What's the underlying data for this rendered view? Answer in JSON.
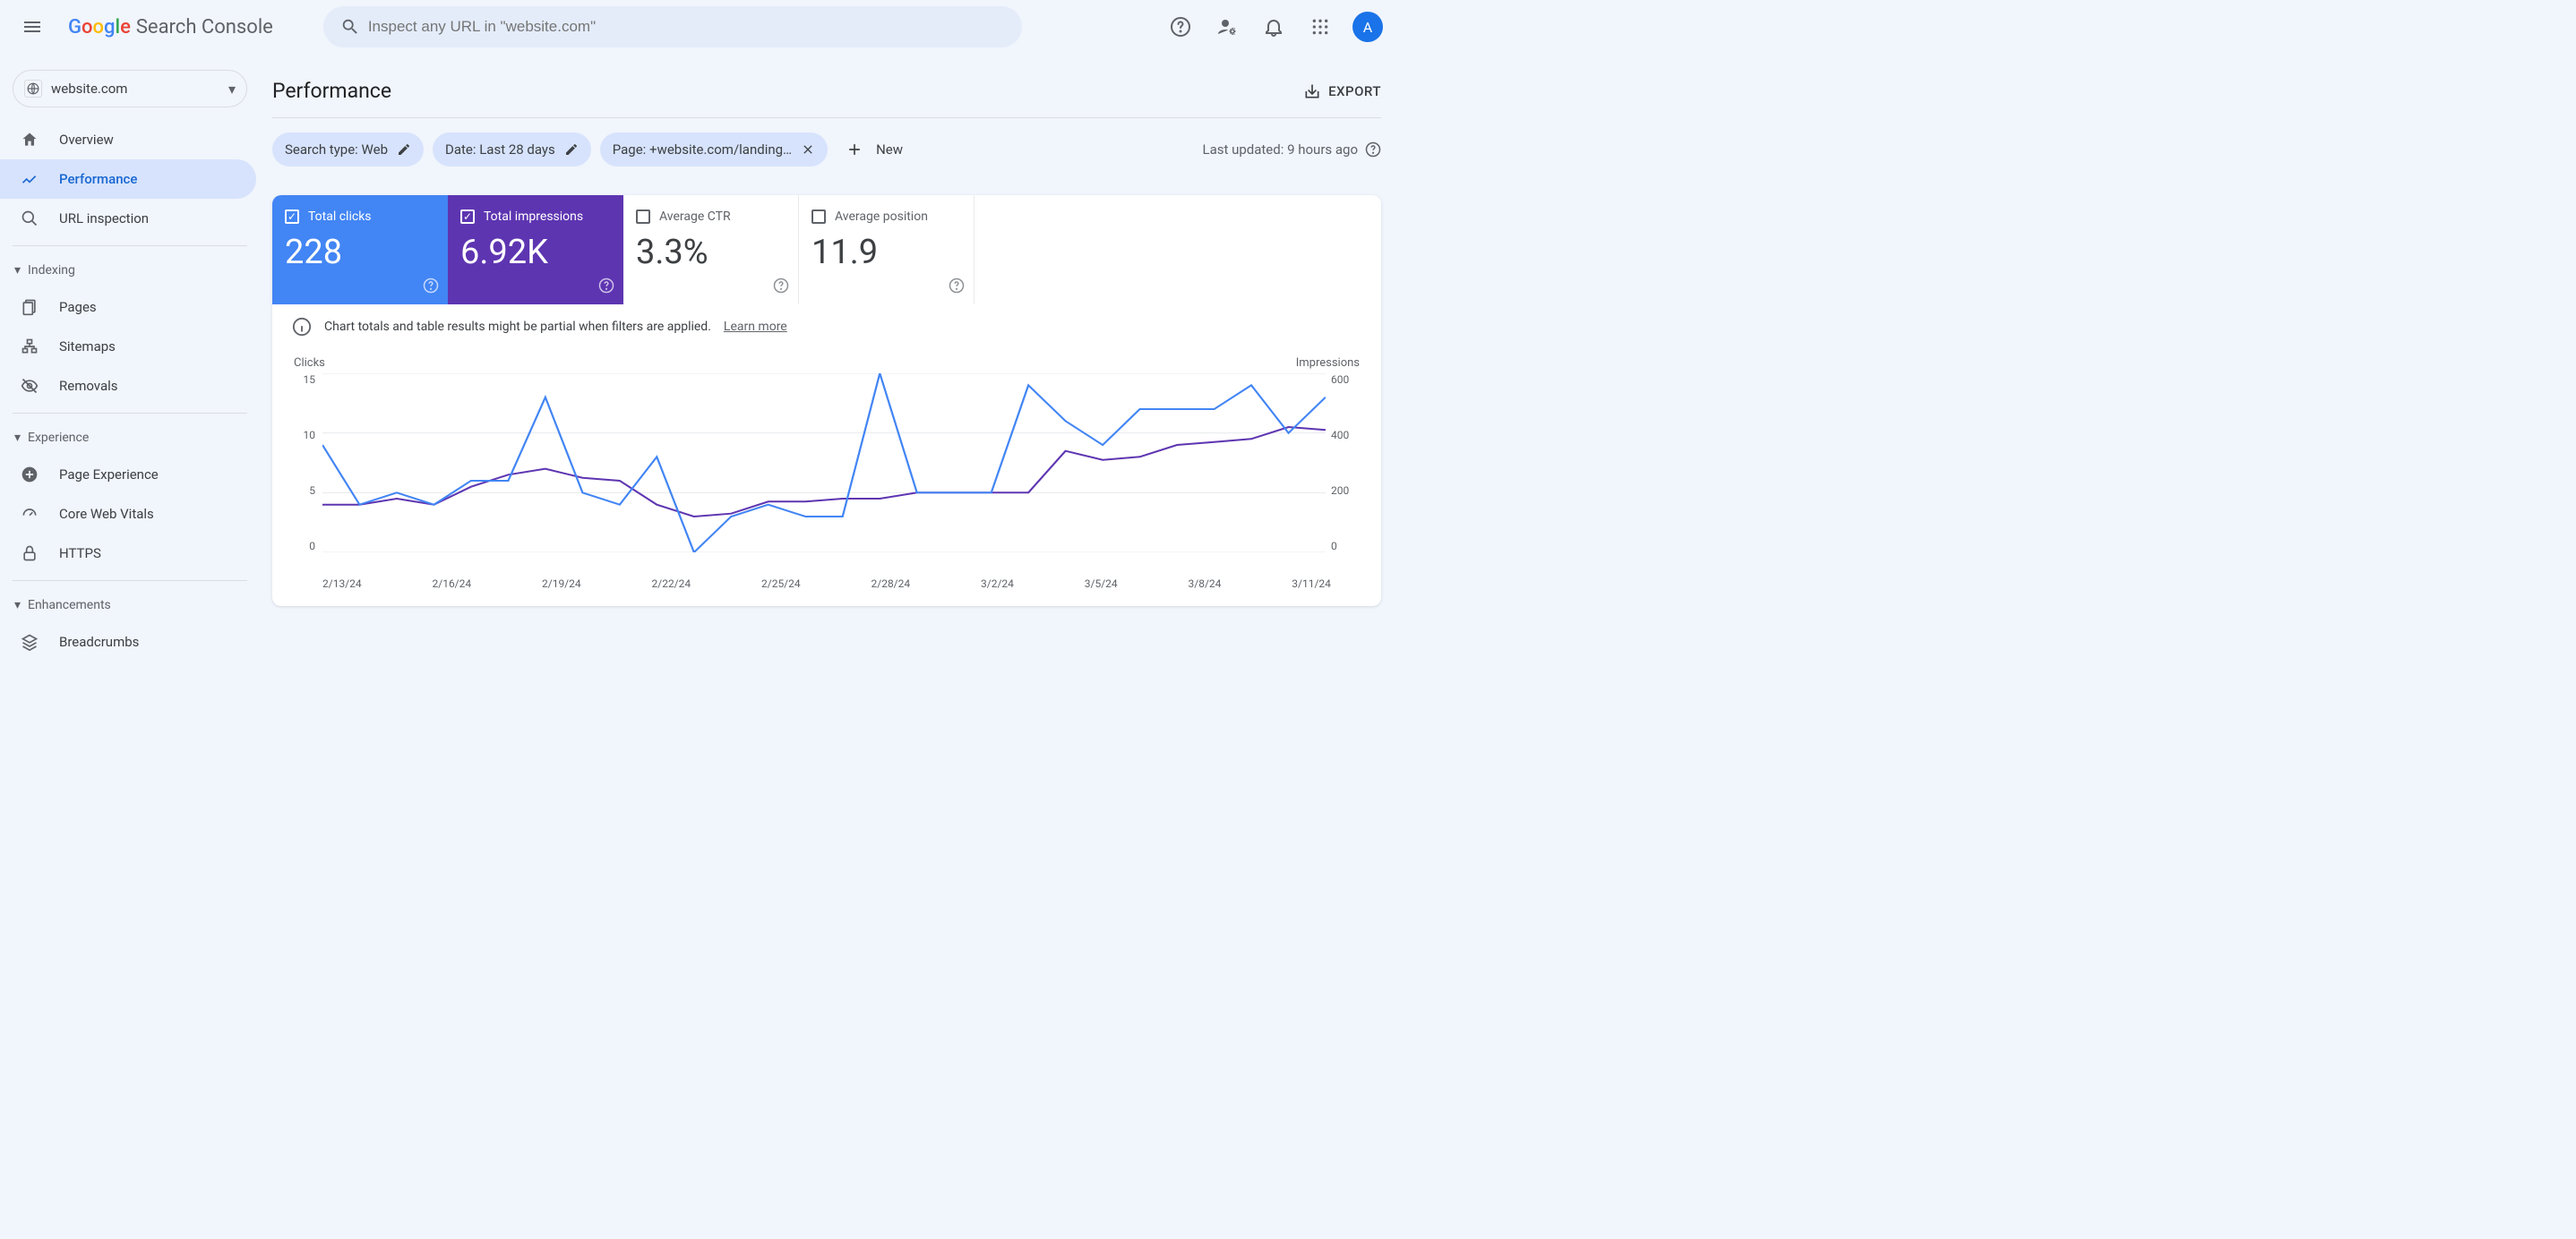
{
  "header": {
    "logo_text": "Search Console",
    "search_placeholder": "Inspect any URL in \"website.com\"",
    "avatar_letter": "A"
  },
  "sidebar": {
    "property": "website.com",
    "items": [
      {
        "id": "overview",
        "label": "Overview"
      },
      {
        "id": "performance",
        "label": "Performance"
      },
      {
        "id": "url-inspection",
        "label": "URL inspection"
      }
    ],
    "groups": {
      "indexing": {
        "label": "Indexing",
        "items": [
          {
            "id": "pages",
            "label": "Pages"
          },
          {
            "id": "sitemaps",
            "label": "Sitemaps"
          },
          {
            "id": "removals",
            "label": "Removals"
          }
        ]
      },
      "experience": {
        "label": "Experience",
        "items": [
          {
            "id": "page-experience",
            "label": "Page Experience"
          },
          {
            "id": "core-web-vitals",
            "label": "Core Web Vitals"
          },
          {
            "id": "https",
            "label": "HTTPS"
          }
        ]
      },
      "enhancements": {
        "label": "Enhancements",
        "items": [
          {
            "id": "breadcrumbs",
            "label": "Breadcrumbs"
          }
        ]
      }
    }
  },
  "page": {
    "title": "Performance",
    "export_label": "EXPORT",
    "last_updated": "Last updated: 9 hours ago",
    "filters": {
      "search_type": "Search type: Web",
      "date": "Date: Last 28 days",
      "page": "Page: +website.com/landing…",
      "new_label": "New"
    },
    "metrics": {
      "clicks": {
        "label": "Total clicks",
        "value": "228"
      },
      "impressions": {
        "label": "Total impressions",
        "value": "6.92K"
      },
      "ctr": {
        "label": "Average CTR",
        "value": "3.3%"
      },
      "position": {
        "label": "Average position",
        "value": "11.9"
      }
    },
    "info_text": "Chart totals and table results might be partial when filters are applied.",
    "learn_more": "Learn more"
  },
  "chart_data": {
    "type": "line",
    "title": "",
    "x_dates": [
      "2/13/24",
      "2/16/24",
      "2/19/24",
      "2/22/24",
      "2/25/24",
      "2/28/24",
      "3/2/24",
      "3/5/24",
      "3/8/24",
      "3/11/24"
    ],
    "y_left_label": "Clicks",
    "y_right_label": "Impressions",
    "y_left_ticks": [
      15,
      10,
      5,
      0
    ],
    "y_right_ticks": [
      600,
      400,
      200,
      0
    ],
    "series": [
      {
        "name": "Clicks",
        "axis": "left",
        "color": "#4285f4",
        "values": [
          9,
          4,
          5,
          4,
          6,
          6,
          13,
          5,
          4,
          8,
          0,
          3,
          4,
          3,
          3,
          15,
          5,
          5,
          5,
          14,
          11,
          9,
          12,
          12,
          12,
          14,
          10,
          13
        ]
      },
      {
        "name": "Impressions",
        "axis": "right",
        "color": "#5e35b1",
        "values": [
          160,
          160,
          180,
          160,
          220,
          260,
          280,
          250,
          240,
          160,
          120,
          130,
          170,
          170,
          180,
          180,
          200,
          200,
          200,
          200,
          340,
          310,
          320,
          360,
          370,
          380,
          420,
          410
        ]
      }
    ]
  }
}
